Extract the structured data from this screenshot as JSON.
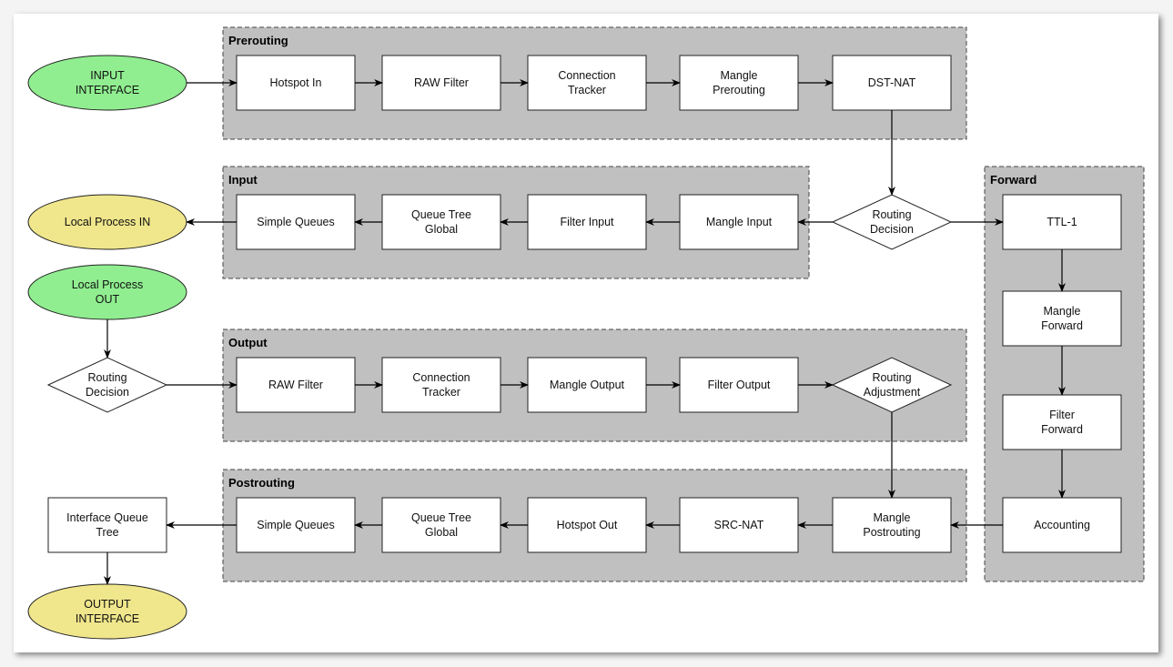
{
  "colors": {
    "start_ellipse": "#90ee90",
    "end_ellipse": "#f0e68c",
    "group_fill": "#c0c0c0"
  },
  "groups": {
    "prerouting": "Prerouting",
    "input": "Input",
    "output": "Output",
    "postrouting": "Postrouting",
    "forward": "Forward"
  },
  "nodes": {
    "input_interface": [
      "INPUT",
      "INTERFACE"
    ],
    "local_in": [
      "Local Process IN"
    ],
    "local_out": [
      "Local Process",
      "OUT"
    ],
    "routing_decision_out": [
      "Routing",
      "Decision"
    ],
    "iface_queue": [
      "Interface Queue",
      "Tree"
    ],
    "output_interface": [
      "OUTPUT",
      "INTERFACE"
    ],
    "pre_hotspot": [
      "Hotspot In"
    ],
    "pre_raw": [
      "RAW Filter"
    ],
    "pre_conn": [
      "Connection",
      "Tracker"
    ],
    "pre_mangle": [
      "Mangle",
      "Prerouting"
    ],
    "pre_dstnat": [
      "DST-NAT"
    ],
    "in_sq": [
      "Simple Queues"
    ],
    "in_qt": [
      "Queue Tree",
      "Global"
    ],
    "in_filter": [
      "Filter Input"
    ],
    "in_mangle": [
      "Mangle Input"
    ],
    "routing_decision": [
      "Routing",
      "Decision"
    ],
    "fw_ttl": [
      "TTL-1"
    ],
    "fw_mangle": [
      "Mangle",
      "Forward"
    ],
    "fw_filter": [
      "Filter",
      "Forward"
    ],
    "fw_acct": [
      "Accounting"
    ],
    "out_raw": [
      "RAW Filter"
    ],
    "out_conn": [
      "Connection",
      "Tracker"
    ],
    "out_mangle": [
      "Mangle Output"
    ],
    "out_filter": [
      "Filter Output"
    ],
    "routing_adjust": [
      "Routing",
      "Adjustment"
    ],
    "post_sq": [
      "Simple Queues"
    ],
    "post_qt": [
      "Queue Tree",
      "Global"
    ],
    "post_hotspot": [
      "Hotspot Out"
    ],
    "post_srcnat": [
      "SRC-NAT"
    ],
    "post_mangle": [
      "Mangle",
      "Postrouting"
    ]
  }
}
